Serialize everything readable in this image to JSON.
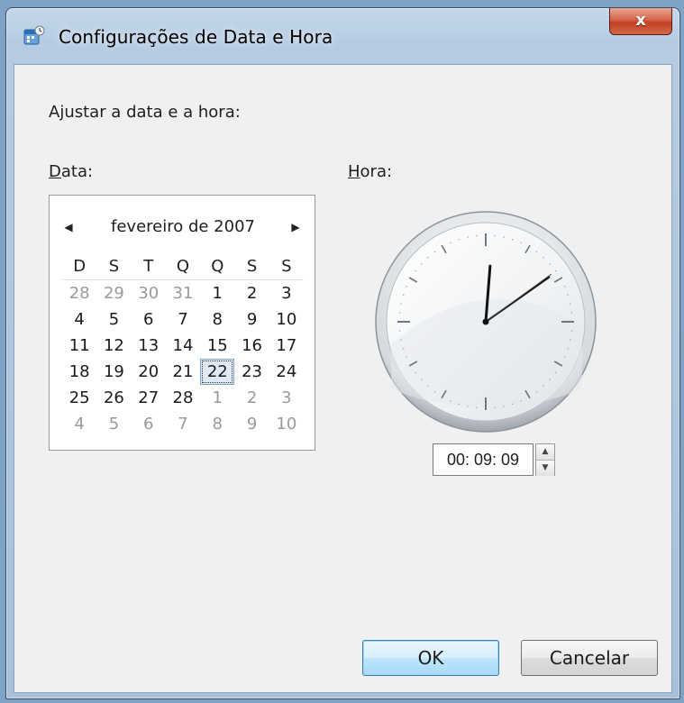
{
  "window": {
    "title": "Configurações de Data e Hora",
    "close_label": "x"
  },
  "instruction": "Ajustar a data e a hora:",
  "date": {
    "label_accel": "D",
    "label_rest": "ata:",
    "calendar": {
      "month_year": "fevereiro de 2007",
      "prev_icon": "◀",
      "next_icon": "▶",
      "weekdays": [
        "D",
        "S",
        "T",
        "Q",
        "Q",
        "S",
        "S"
      ],
      "weeks": [
        [
          {
            "d": "28",
            "o": true
          },
          {
            "d": "29",
            "o": true
          },
          {
            "d": "30",
            "o": true
          },
          {
            "d": "31",
            "o": true
          },
          {
            "d": "1"
          },
          {
            "d": "2"
          },
          {
            "d": "3"
          }
        ],
        [
          {
            "d": "4"
          },
          {
            "d": "5"
          },
          {
            "d": "6"
          },
          {
            "d": "7"
          },
          {
            "d": "8"
          },
          {
            "d": "9"
          },
          {
            "d": "10"
          }
        ],
        [
          {
            "d": "11"
          },
          {
            "d": "12"
          },
          {
            "d": "13"
          },
          {
            "d": "14"
          },
          {
            "d": "15"
          },
          {
            "d": "16"
          },
          {
            "d": "17"
          }
        ],
        [
          {
            "d": "18"
          },
          {
            "d": "19"
          },
          {
            "d": "20"
          },
          {
            "d": "21"
          },
          {
            "d": "22",
            "today": true
          },
          {
            "d": "23"
          },
          {
            "d": "24"
          }
        ],
        [
          {
            "d": "25"
          },
          {
            "d": "26"
          },
          {
            "d": "27"
          },
          {
            "d": "28"
          },
          {
            "d": "1",
            "o": true
          },
          {
            "d": "2",
            "o": true
          },
          {
            "d": "3",
            "o": true
          }
        ],
        [
          {
            "d": "4",
            "o": true
          },
          {
            "d": "5",
            "o": true
          },
          {
            "d": "6",
            "o": true
          },
          {
            "d": "7",
            "o": true
          },
          {
            "d": "8",
            "o": true
          },
          {
            "d": "9",
            "o": true
          },
          {
            "d": "10",
            "o": true
          }
        ]
      ]
    }
  },
  "time": {
    "label_accel": "H",
    "label_rest": "ora:",
    "value": "00: 09: 09",
    "clock": {
      "hours": 0,
      "minutes": 9,
      "seconds": 9
    }
  },
  "buttons": {
    "ok": "OK",
    "cancel": "Cancelar"
  },
  "colors": {
    "titlebar": "#b4cbe2",
    "close": "#c2401f",
    "client": "#f0f0f0"
  }
}
